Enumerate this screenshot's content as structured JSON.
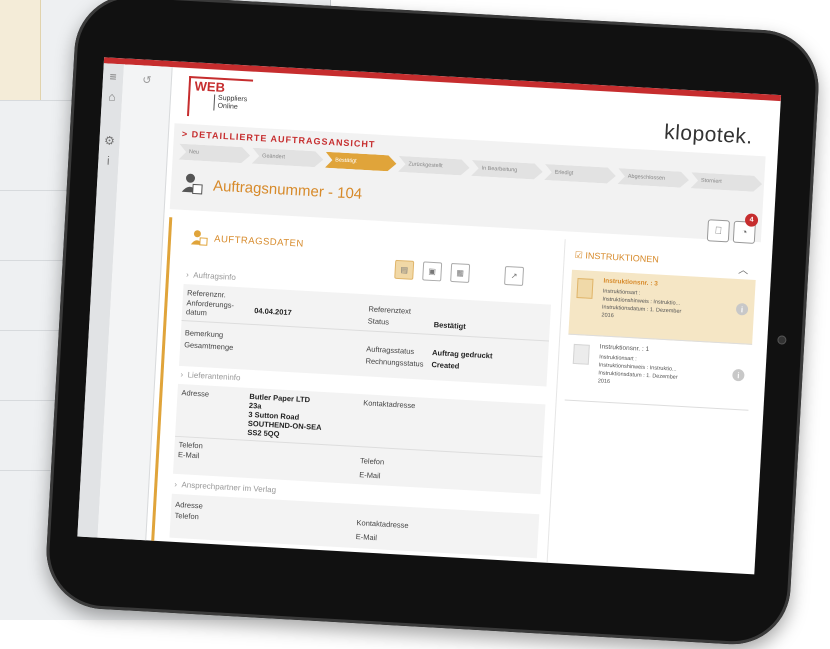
{
  "logo": {
    "web": "WEB",
    "line1": "Suppliers",
    "line2": "Online"
  },
  "brand": "klopotek.",
  "page": {
    "title": "> DETAILLIERTE AUFTRAGSANSICHT",
    "order_title": "Auftragsnummer - 104",
    "badge_count": "4"
  },
  "steps": [
    "Neu",
    "Geändert",
    "Bestätigt",
    "Zurückgestellt",
    "In Bearbeitung",
    "Erledigt",
    "Abgeschlossen",
    "Storniert"
  ],
  "active_step": "Bestätigt",
  "section": {
    "title": "AUFTRAGSDATEN"
  },
  "auftragsinfo": {
    "heading": "Auftragsinfo",
    "referenznr_label": "Referenznr.",
    "anforderungsdatum_label1": "Anforderungs-",
    "anforderungsdatum_label2": "datum",
    "anforderungsdatum_value": "04.04.2017",
    "referenztext_label": "Referenztext",
    "status_label": "Status",
    "status_value": "Bestätigt",
    "bemerkung_label": "Bemerkung",
    "gesamtmenge_label": "Gesamtmenge",
    "auftragsstatus_label": "Auftragsstatus",
    "auftragsstatus_value": "Auftrag gedruckt",
    "rechnungsstatus_label": "Rechnungsstatus",
    "rechnungsstatus_value": "Created"
  },
  "lieferanteninfo": {
    "heading": "Lieferanteninfo",
    "adresse_label": "Adresse",
    "adresse_lines": [
      "Butler Paper LTD",
      "23a",
      "3 Sutton Road",
      "SOUTHEND-ON-SEA",
      "SS2 5QQ"
    ],
    "kontaktadresse_label": "Kontaktadresse",
    "telefon_label": "Telefon",
    "email_label": "E-Mail",
    "telefon2_label": "Telefon",
    "email2_label": "E-Mail"
  },
  "ansprechpartner": {
    "heading": "Ansprechpartner im Verlag",
    "adresse_label": "Adresse",
    "telefon_label": "Telefon",
    "kontaktadresse_label": "Kontaktadresse",
    "email_label": "E-Mail"
  },
  "instruktionen": {
    "title": "INSTRUKTIONEN",
    "cards": [
      {
        "nr": "Instruktionsnr. : 3",
        "art": "Instruktionsart :",
        "hinweis": "Instruktionshinweis : Instruktio...",
        "datum1": "Instruktionsdatum : 1. Dezember",
        "datum2": "2016"
      },
      {
        "nr": "Instruktionsnr. : 1",
        "art": "Instruktionsart :",
        "hinweis": "Instruktionshinweis : Instruktio...",
        "datum1": "Instruktionsdatum : 1. Dezember",
        "datum2": "2016"
      }
    ]
  }
}
